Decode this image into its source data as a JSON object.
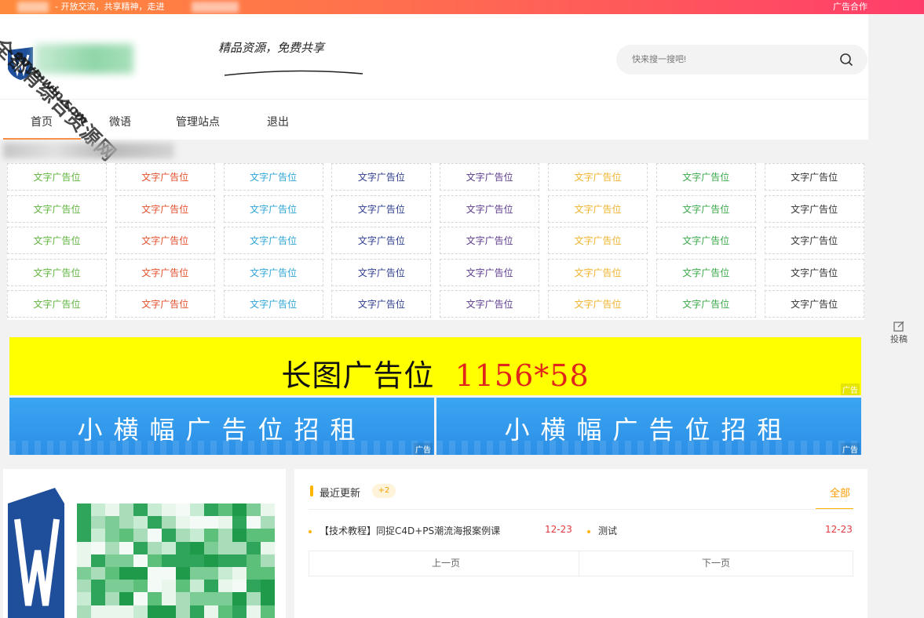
{
  "topbar": {
    "tagline": "- 开放交流，共享精神，走进",
    "ad_link": "广告合作"
  },
  "header": {
    "slogan": "精品资源，免费共享",
    "search": {
      "placeholder": "快来搜一搜吧!"
    }
  },
  "nav": {
    "items": [
      "首页",
      "微语",
      "管理站点",
      "退出"
    ],
    "active": "首页"
  },
  "watermark": {
    "line1": "全都有综合资源网",
    "line2": "ouyouvip.com"
  },
  "text_ads": {
    "label": "文字广告位",
    "column_colors": [
      "#5fb43c",
      "#e4502c",
      "#2ea4d6",
      "#2f3d8f",
      "#5c3c8c",
      "#f0b32c",
      "#3aa84a",
      "#333333"
    ],
    "rows": 5
  },
  "banner": {
    "text": "长图广告位",
    "size": "1156*58",
    "tag": "广告"
  },
  "small_banners": [
    {
      "text": "小横幅广告位招租",
      "tag": "广告"
    },
    {
      "text": "小横幅广告位招租",
      "tag": "广告"
    }
  ],
  "side": {
    "label": "投稿"
  },
  "news": {
    "title": "最近更新",
    "badge": "+2",
    "all_link": "全部",
    "items": [
      {
        "title": "【技术教程】同捉C4D+PS潮流海报案例课",
        "date": "12-23"
      },
      {
        "title": "测试",
        "date": "12-23"
      }
    ],
    "prev": "上一页",
    "next": "下一页"
  },
  "colors": {
    "accent": "#ff8a3c",
    "banner_yellow": "#ffff00",
    "banner_red": "#e0251a",
    "small_banner_blue": "#3aa5f2",
    "date_red": "#e4393c"
  }
}
